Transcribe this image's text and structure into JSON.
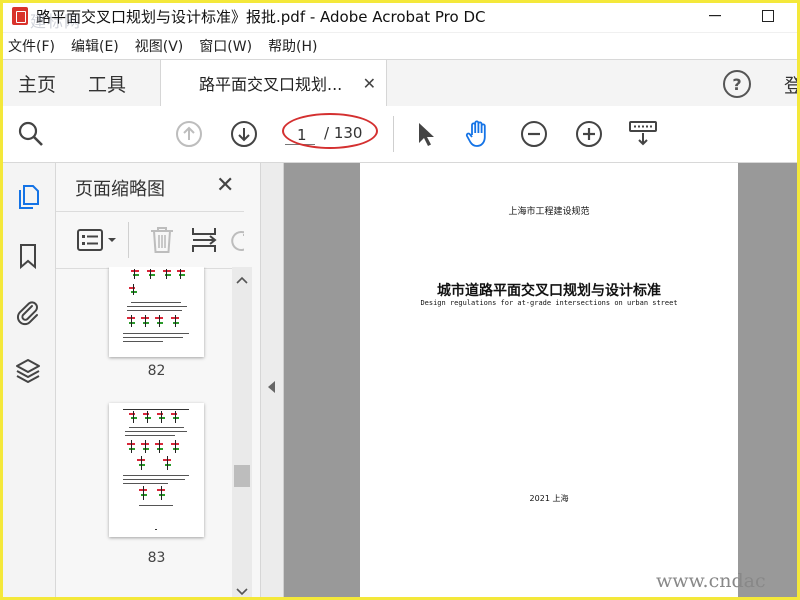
{
  "window": {
    "title": "路平面交叉口规划与设计标准》报批.pdf - Adobe Acrobat Pro DC",
    "watermark": "建标网"
  },
  "menu": [
    "文件(F)",
    "编辑(E)",
    "视图(V)",
    "窗口(W)",
    "帮助(H)"
  ],
  "tabs": {
    "home": "主页",
    "tools": "工具",
    "document": "路平面交叉口规划...",
    "login": "登"
  },
  "toolbar": {
    "current_page": "1",
    "page_total": "/ 130"
  },
  "panel": {
    "title": "页面缩略图",
    "thumbnails": [
      {
        "page_label": "82"
      },
      {
        "page_label": "83"
      }
    ]
  },
  "document_page": {
    "header": "上海市工程建设规范",
    "title": "城市道路平面交叉口规划与设计标准",
    "subtitle": "Design regulations for at-grade intersections on urban street",
    "footer": "2021 上海"
  },
  "site_watermark": "www.cndac",
  "colors": {
    "accent": "#1473e6",
    "annotation": "#d43030",
    "frame": "#f4e83a"
  },
  "icons": [
    "pdf-icon",
    "minimize-icon",
    "maximize-icon",
    "help-icon",
    "close-icon",
    "search-icon",
    "arrow-up-icon",
    "arrow-down-icon",
    "select-pointer-icon",
    "hand-icon",
    "zoom-out-icon",
    "zoom-in-icon",
    "page-display-icon",
    "pages-icon",
    "bookmark-icon",
    "attachment-icon",
    "layers-icon",
    "options-icon",
    "delete-icon",
    "insert-icon",
    "rotate-icon"
  ]
}
